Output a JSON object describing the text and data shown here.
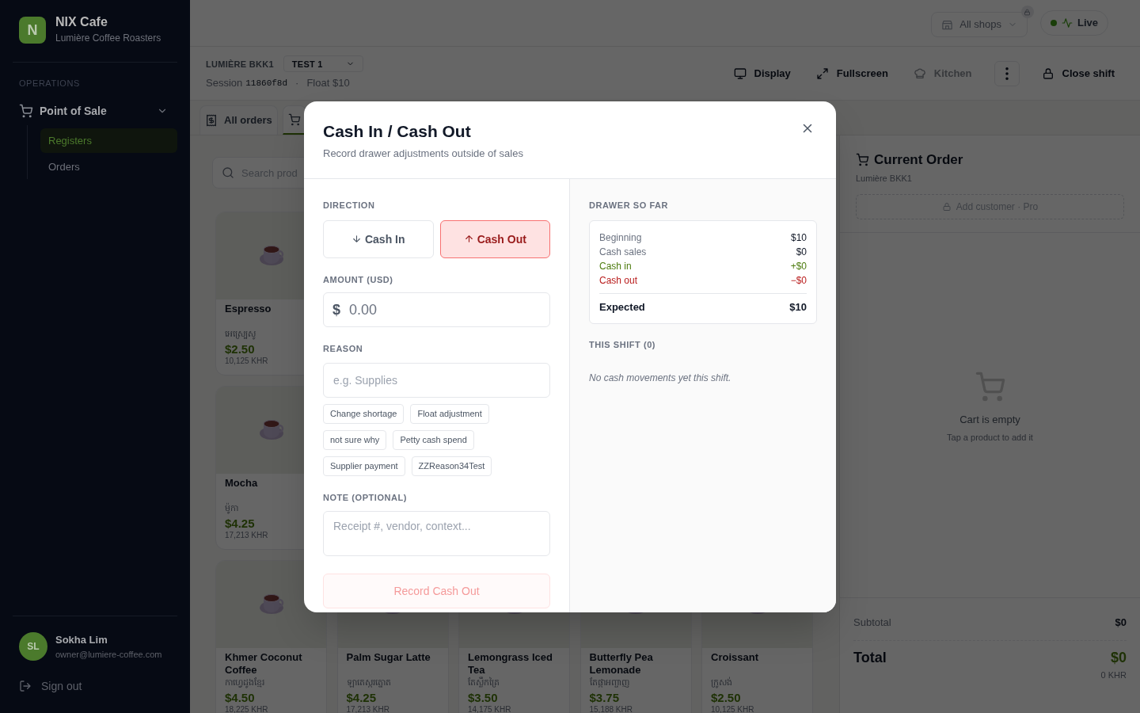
{
  "sidebar": {
    "brand": {
      "initial": "N",
      "name": "NIX Cafe",
      "subtitle": "Lumière Coffee Roasters"
    },
    "section": "OPERATIONS",
    "nav": [
      {
        "label": "Point of Sale",
        "expanded": true,
        "children": [
          {
            "label": "Registers",
            "selected": true
          },
          {
            "label": "Orders",
            "selected": false
          }
        ]
      }
    ],
    "user": {
      "initials": "SL",
      "name": "Sokha Lim",
      "email": "owner@lumiere-coffee.com"
    },
    "sign_out": "Sign out"
  },
  "topbar": {
    "shop_picker": "All shops",
    "status": {
      "label": "Live",
      "on": true
    }
  },
  "register_bar": {
    "location": "LUMIÈRE BKK1",
    "register": "TEST 1",
    "session_label": "Session",
    "session_id": "11860f8d",
    "separator": "·",
    "float": "Float $10",
    "actions": [
      {
        "kind": "display",
        "label": "Display",
        "disabled": false
      },
      {
        "kind": "fullscreen",
        "label": "Fullscreen",
        "disabled": false
      },
      {
        "kind": "kitchen",
        "label": "Kitchen",
        "disabled": true
      },
      {
        "kind": "more"
      },
      {
        "kind": "lock",
        "label": "Close shift",
        "disabled": false
      }
    ]
  },
  "tabs": [
    {
      "kind": "receipt",
      "label": "All orders",
      "selected": false
    },
    {
      "kind": "cart",
      "selected": true
    }
  ],
  "search": {
    "placeholder": "Search prod"
  },
  "product_rows": [
    [
      {
        "name": "Espresso",
        "local_name": "អេស្ប្រេសូ",
        "price": "$2.50",
        "khr": "10,125 KHR"
      }
    ],
    [
      {
        "name": "Mocha",
        "local_name": "ម៉ូកា",
        "price": "$4.25",
        "khr": "17,213 KHR"
      }
    ],
    [
      {
        "name": "Khmer Coconut Coffee",
        "local_name": "កាហ្វេដូងខ្មែរ",
        "price": "$4.50",
        "khr": "18,225 KHR"
      },
      {
        "name": "Palm Sugar Latte",
        "local_name": "ឡាតេស្ករត្នោត",
        "price": "$4.25",
        "khr": "17,213 KHR"
      },
      {
        "name": "Lemongrass Iced Tea",
        "local_name": "តែស្លឹកគ្រៃ",
        "price": "$3.50",
        "khr": "14,175 KHR"
      },
      {
        "name": "Butterfly Pea Lemonade",
        "local_name": "តែផ្កាអញ្ចាញ",
        "price": "$3.75",
        "khr": "15,188 KHR"
      },
      {
        "name": "Croissant",
        "local_name": "ក្រូសង់",
        "price": "$2.50",
        "khr": "10,125 KHR"
      }
    ]
  ],
  "order": {
    "title": "Current Order",
    "location": "Lumière BKK1",
    "add_customer": "Add customer · Pro",
    "empty_title": "Cart is empty",
    "empty_hint": "Tap a product to add it",
    "subtotal_label": "Subtotal",
    "subtotal": "$0",
    "total_label": "Total",
    "total": "$0",
    "total_khr": "0 KHR"
  },
  "dialog": {
    "title": "Cash In / Cash Out",
    "subtitle": "Record drawer adjustments outside of sales",
    "direction_label": "DIRECTION",
    "directions": [
      {
        "kind": "in",
        "label": "Cash In",
        "selected": false
      },
      {
        "kind": "out",
        "label": "Cash Out",
        "selected": true
      }
    ],
    "amount_label": "AMOUNT (USD)",
    "currency": "$",
    "amount_placeholder": "0.00",
    "reason_label": "REASON",
    "reason_placeholder": "e.g. Supplies",
    "reason_chips": [
      [
        "Change shortage",
        "Float adjustment"
      ],
      [
        "not sure why",
        "Petty cash spend"
      ],
      [
        "Supplier payment",
        "ZZReason34Test"
      ]
    ],
    "note_label": "NOTE (OPTIONAL)",
    "note_placeholder": "Receipt #, vendor, context...",
    "submit": {
      "label": "Record Cash Out",
      "disabled": true
    },
    "drawer_label": "DRAWER SO FAR",
    "drawer_rows": [
      {
        "kind": "plain",
        "label": "Beginning",
        "value": "$10"
      },
      {
        "kind": "plain",
        "label": "Cash sales",
        "value": "$0"
      },
      {
        "kind": "in",
        "label": "Cash in",
        "value": "+$0"
      },
      {
        "kind": "out",
        "label": "Cash out",
        "value": "−$0"
      }
    ],
    "expected": {
      "label": "Expected",
      "value": "$10"
    },
    "shift_label": "THIS SHIFT (0)",
    "shift_empty": "No cash movements yet this shift."
  }
}
